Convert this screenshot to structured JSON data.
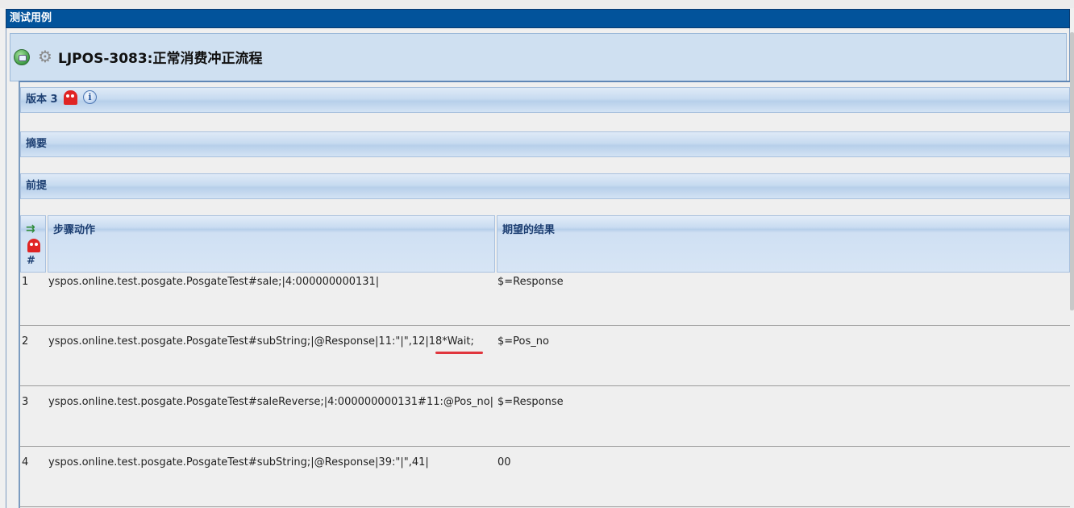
{
  "window": {
    "title": "测试用例"
  },
  "header": {
    "exec_icon": "execute-icon",
    "gear_icon": "gear-icon",
    "testcase_title": "LJPOS-3083:正常消费冲正流程"
  },
  "sections": {
    "version_label": "版本 3",
    "version_icons": [
      "ghost-icon",
      "info-icon"
    ],
    "summary_label": "摘要",
    "precondition_label": "前提"
  },
  "steps_table": {
    "headers": {
      "number": "#",
      "action": "步骤动作",
      "expected": "期望的结果"
    },
    "header_icons": [
      "execute-steps-icon",
      "ghost-icon"
    ],
    "rows": [
      {
        "num": "1",
        "action": "yspos.online.test.posgate.PosgateTest#sale;|4:000000000131|",
        "expected": "$=Response"
      },
      {
        "num": "2",
        "action": "yspos.online.test.posgate.PosgateTest#subString;|@Response|11:\"|\",12|18*Wait;",
        "expected": "$=Pos_no"
      },
      {
        "num": "3",
        "action": "yspos.online.test.posgate.PosgateTest#saleReverse;|4:000000000131#11:@Pos_no|",
        "expected": "$=Response"
      },
      {
        "num": "4",
        "action": "yspos.online.test.posgate.PosgateTest#subString;|@Response|39:\"|\",41|",
        "expected": "00"
      }
    ]
  },
  "colors": {
    "title_bar": "#02539b",
    "section_text": "#1d3f72",
    "highlight_underline": "#e0353d"
  }
}
